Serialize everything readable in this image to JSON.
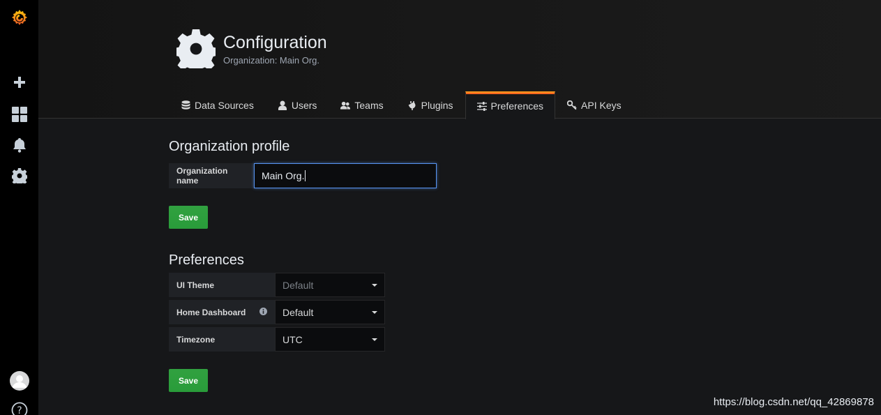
{
  "sidebar": {
    "items": [
      {
        "name": "grafana-logo-icon"
      },
      {
        "name": "plus-icon"
      },
      {
        "name": "dashboards-icon"
      },
      {
        "name": "bell-icon"
      },
      {
        "name": "gear-icon"
      },
      {
        "name": "avatar-icon"
      },
      {
        "name": "help-icon"
      }
    ]
  },
  "header": {
    "title": "Configuration",
    "subtitle": "Organization: Main Org."
  },
  "tabs": [
    {
      "label": "Data Sources",
      "icon": "database-icon"
    },
    {
      "label": "Users",
      "icon": "user-icon"
    },
    {
      "label": "Teams",
      "icon": "users-icon"
    },
    {
      "label": "Plugins",
      "icon": "plug-icon"
    },
    {
      "label": "Preferences",
      "icon": "sliders-icon",
      "active": true
    },
    {
      "label": "API Keys",
      "icon": "key-icon"
    }
  ],
  "org_profile": {
    "title": "Organization profile",
    "name_label": "Organization name",
    "name_value": "Main Org.",
    "save_label": "Save"
  },
  "preferences": {
    "title": "Preferences",
    "ui_theme_label": "UI Theme",
    "ui_theme_value": "Default",
    "home_dashboard_label": "Home Dashboard",
    "home_dashboard_value": "Default",
    "timezone_label": "Timezone",
    "timezone_value": "UTC",
    "save_label": "Save"
  },
  "watermark": "https://blog.csdn.net/qq_42869878",
  "colors": {
    "accent": "#f7941d",
    "save": "#299c3a",
    "background": "#161719"
  }
}
